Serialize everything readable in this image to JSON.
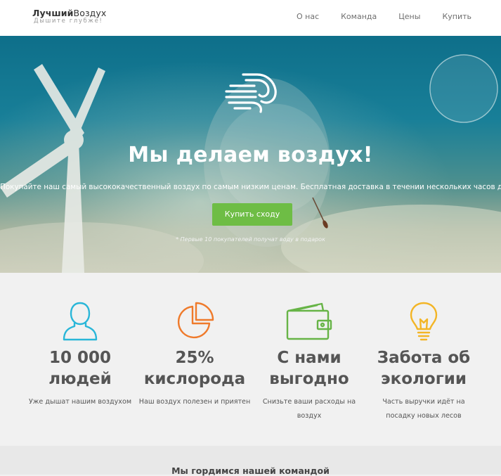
{
  "header": {
    "logo_bold": "Лучший",
    "logo_light": "Воздух",
    "logo_tagline": "Дышите глубже!",
    "nav": [
      "О нас",
      "Команда",
      "Цены",
      "Купить"
    ]
  },
  "hero": {
    "icon": "wind-icon",
    "title": "Мы делаем воздух!",
    "text": "Покупайте наш самый высококачественный воздух по самым низким ценам. Бесплатная доставка в течении нескольких часов до подъезда.",
    "button": "Купить сходу",
    "note": "* Первые 10 покупателей получат воду в подарок"
  },
  "features": [
    {
      "icon": "user-icon",
      "color": "#29b6d8",
      "title": "10 000 людей",
      "desc": "Уже дышат нашим воздухом"
    },
    {
      "icon": "pie-chart-icon",
      "color": "#ef7a2b",
      "title": "25% кислорода",
      "desc": "Наш воздух полезен и приятен"
    },
    {
      "icon": "wallet-icon",
      "color": "#67b447",
      "title": "С нами выгодно",
      "desc": "Снизьте ваши расходы на воздух"
    },
    {
      "icon": "lightbulb-icon",
      "color": "#f3b526",
      "title": "Забота об экологии",
      "desc": "Часть выручки идёт на посадку новых лесов"
    }
  ],
  "team": {
    "title": "Мы гордимся нашей командой"
  },
  "colors": {
    "accent_button": "#6ebd45",
    "hero_sky": "#187f98"
  }
}
